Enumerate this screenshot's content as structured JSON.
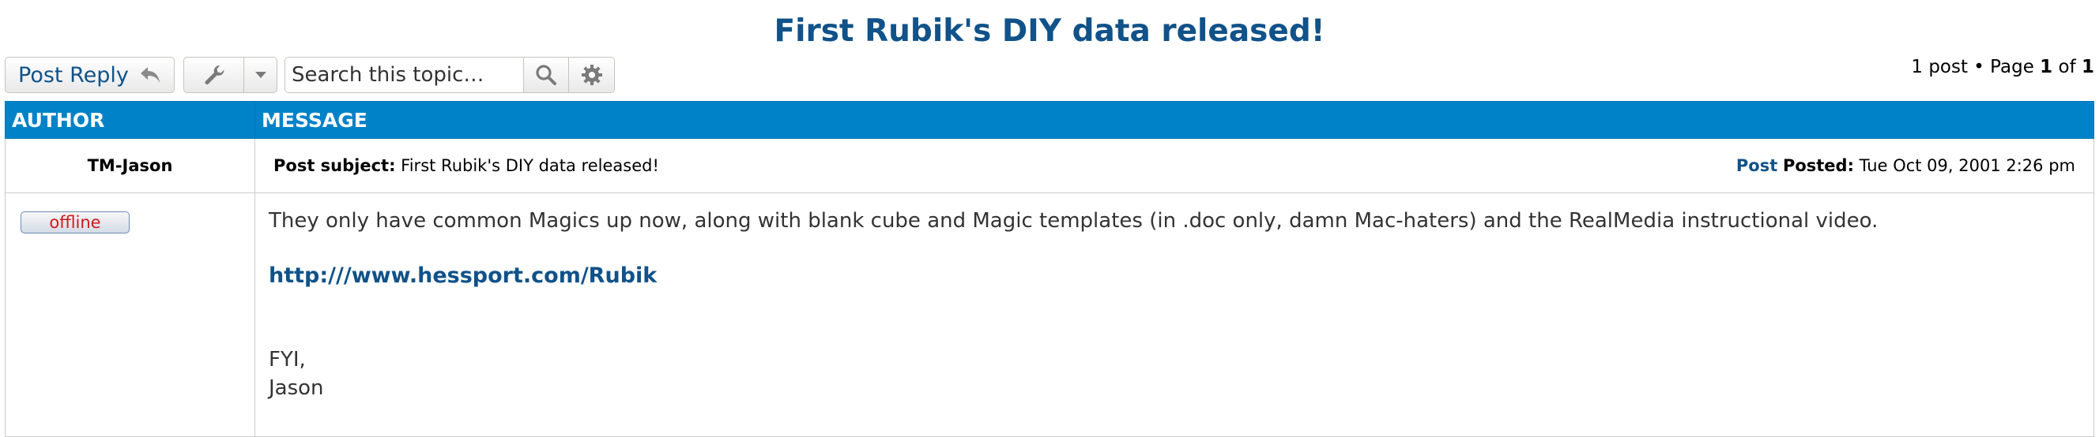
{
  "topic": {
    "title": "First Rubik's DIY data released!"
  },
  "actions": {
    "post_reply_label": "Post Reply",
    "search_placeholder": "Search this topic…"
  },
  "pagination": {
    "count_text": "1 post • Page ",
    "current_page": "1",
    "of_text": " of ",
    "total_pages": "1"
  },
  "table": {
    "author_header": "AUTHOR",
    "message_header": "MESSAGE"
  },
  "post": {
    "author": "TM-Jason",
    "status_badge": "offline",
    "subject_label": "Post subject:",
    "subject": "First Rubik's DIY data released!",
    "post_link": "Post",
    "posted_label": "Posted:",
    "posted_date": "Tue Oct 09, 2001 2:26 pm",
    "body_text": "They only have common Magics up now, along with blank cube and Magic templates (in .doc only, damn Mac-haters) and the RealMedia instructional video.",
    "link_text": "http:///www.hessport.com/Rubik",
    "sig_line1": "FYI,",
    "sig_line2": "Jason"
  },
  "colors": {
    "header_blue": "#0082c8",
    "link_blue": "#105289",
    "offline_red": "#d11a1a"
  },
  "icons": [
    "reply-icon",
    "wrench-icon",
    "caret-down-icon",
    "search-icon",
    "gear-icon"
  ]
}
